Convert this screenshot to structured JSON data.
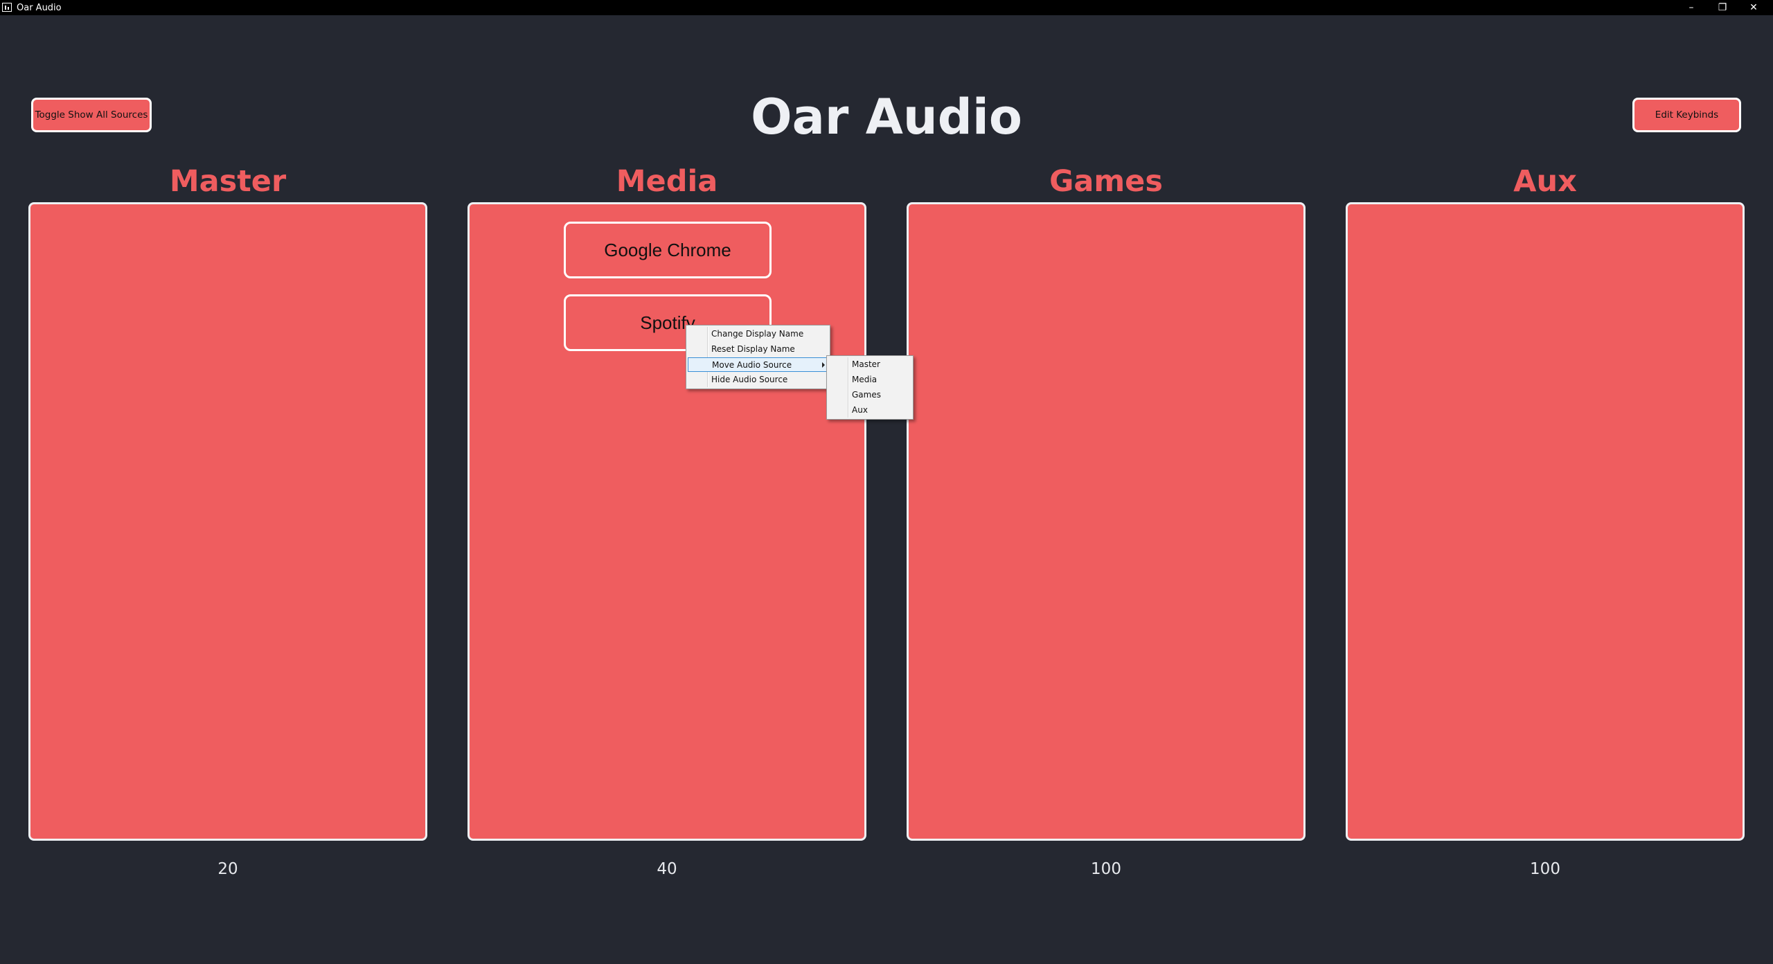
{
  "window": {
    "title": "Oar Audio",
    "controls": {
      "minimize": "–",
      "restore": "❐",
      "close": "✕"
    }
  },
  "header": {
    "title": "Oar Audio",
    "toggle_button": "Toggle Show All Sources",
    "keybinds_button": "Edit Keybinds"
  },
  "columns": [
    {
      "label": "Master",
      "volume": "20",
      "sources": []
    },
    {
      "label": "Media",
      "volume": "40",
      "sources": [
        "Google Chrome",
        "Spotify"
      ]
    },
    {
      "label": "Games",
      "volume": "100",
      "sources": []
    },
    {
      "label": "Aux",
      "volume": "100",
      "sources": []
    }
  ],
  "context_menu": {
    "items": [
      "Change Display Name",
      "Reset Display Name",
      "Move Audio Source",
      "Hide Audio Source"
    ],
    "highlighted": "Move Audio Source",
    "submenu": [
      "Master",
      "Media",
      "Games",
      "Aux"
    ]
  },
  "colors": {
    "background": "#252831",
    "accent": "#ef5d5f",
    "title_text": "#eef0f4"
  }
}
